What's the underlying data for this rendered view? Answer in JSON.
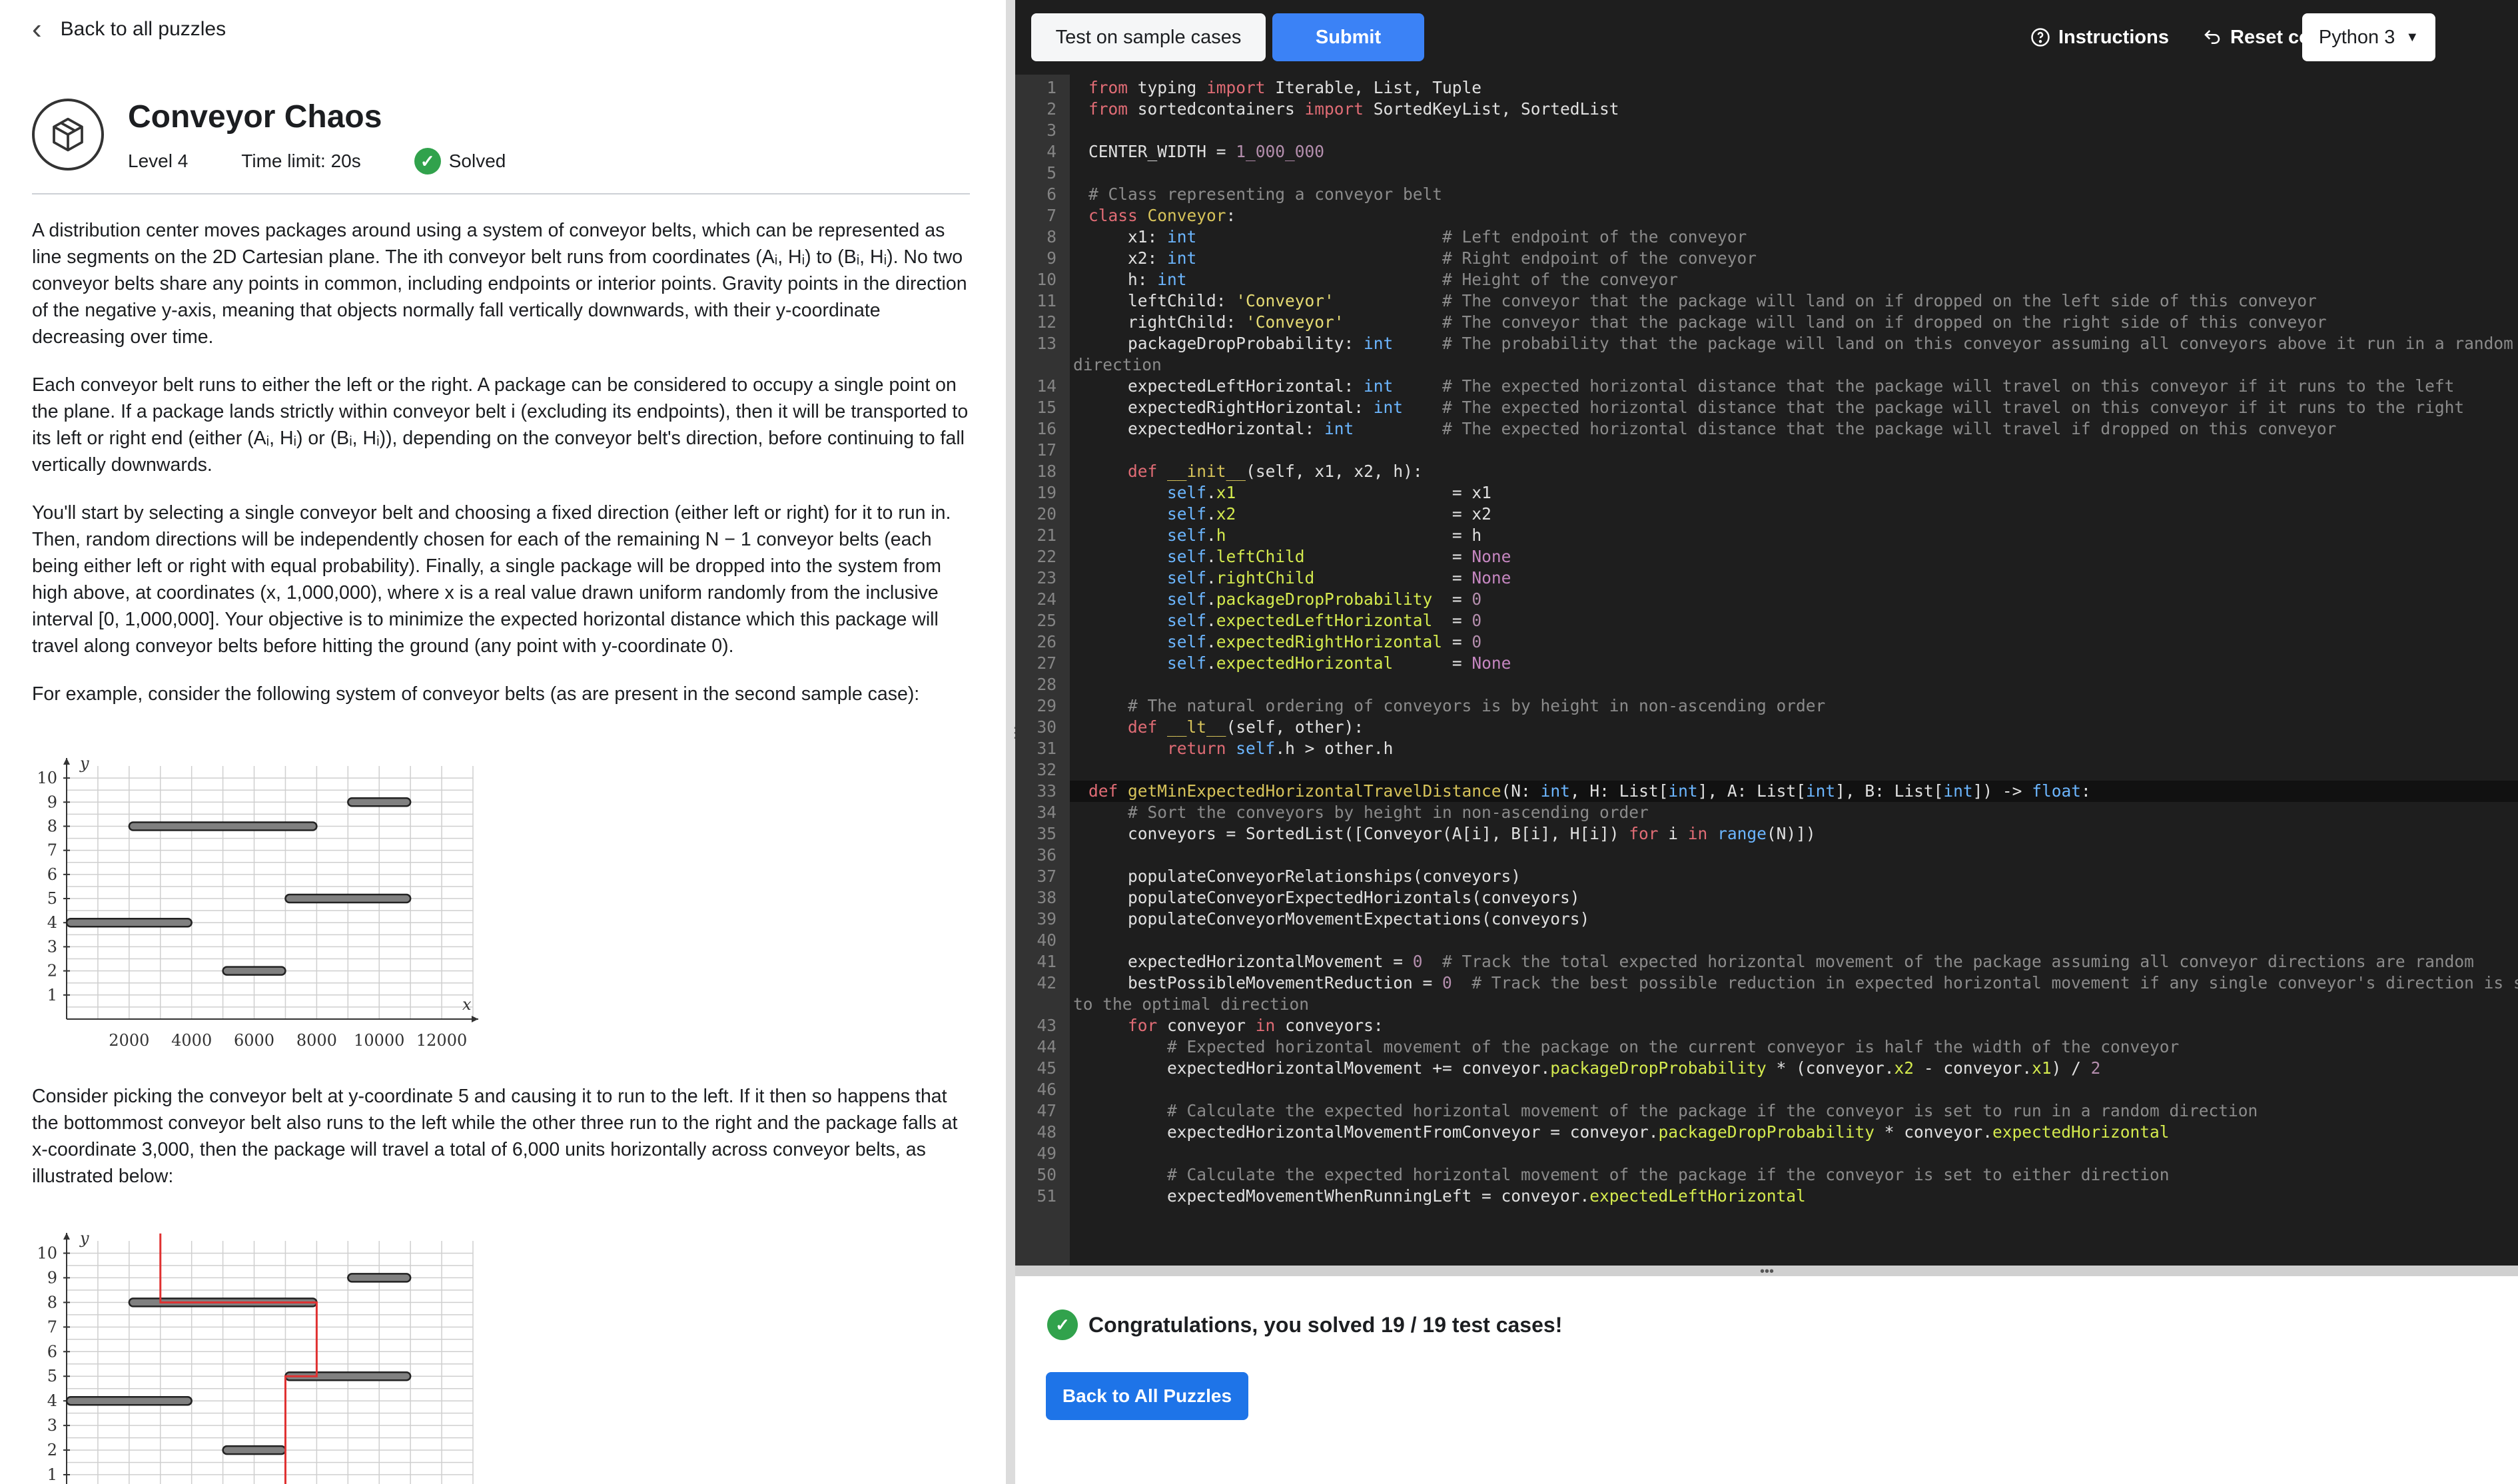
{
  "nav": {
    "back_label": "Back to all puzzles"
  },
  "puzzle": {
    "title": "Conveyor Chaos",
    "level": "Level 4",
    "time_limit": "Time limit: 20s",
    "status": "Solved"
  },
  "description": {
    "p1": "A distribution center moves packages around using a system of conveyor belts, which can be represented as line segments on the 2D Cartesian plane. The ith conveyor belt runs from coordinates (Aᵢ, Hᵢ) to (Bᵢ, Hᵢ). No two conveyor belts share any points in common, including endpoints or interior points. Gravity points in the direction of the negative y-axis, meaning that objects normally fall vertically downwards, with their y-coordinate decreasing over time.",
    "p2": "Each conveyor belt runs to either the left or the right. A package can be considered to occupy a single point on the plane. If a package lands strictly within conveyor belt i (excluding its endpoints), then it will be transported to its left or right end (either (Aᵢ, Hᵢ) or (Bᵢ, Hᵢ)), depending on the conveyor belt's direction, before continuing to fall vertically downwards.",
    "p3": "You'll start by selecting a single conveyor belt and choosing a fixed direction (either left or right) for it to run in. Then, random directions will be independently chosen for each of the remaining N − 1 conveyor belts (each being either left or right with equal probability). Finally, a single package will be dropped into the system from high above, at coordinates (x, 1,000,000), where x is a real value drawn uniform randomly from the inclusive interval [0, 1,000,000]. Your objective is to minimize the expected horizontal distance which this package will travel along conveyor belts before hitting the ground (any point with y-coordinate 0).",
    "p4": "For example, consider the following system of conveyor belts (as are present in the second sample case):",
    "p5": "Consider picking the conveyor belt at y-coordinate 5 and causing it to run to the left. If it then so happens that the bottommost conveyor belt also runs to the left while the other three run to the right and the package falls at x-coordinate 3,000, then the package will travel a total of 6,000 units horizontally across conveyor belts, as illustrated below:"
  },
  "chart_data": [
    {
      "type": "diagram",
      "xlabel": "x",
      "ylabel": "y",
      "xticks": [
        2000,
        4000,
        6000,
        8000,
        10000,
        12000
      ],
      "yticks": [
        1,
        2,
        3,
        4,
        5,
        6,
        7,
        8,
        9,
        10
      ],
      "xlim": [
        0,
        13000
      ],
      "ylim": [
        0,
        10.5
      ],
      "grid": true,
      "segments": [
        {
          "a": 0,
          "b": 4000,
          "h": 4
        },
        {
          "a": 5000,
          "b": 7000,
          "h": 2
        },
        {
          "a": 2000,
          "b": 8000,
          "h": 8
        },
        {
          "a": 7000,
          "b": 11000,
          "h": 5
        },
        {
          "a": 9000,
          "b": 11000,
          "h": 9
        }
      ]
    },
    {
      "type": "diagram",
      "xlabel": "",
      "ylabel": "y",
      "yticks": [
        1,
        2,
        3,
        4,
        5,
        6,
        7,
        8,
        9,
        10
      ],
      "xlim": [
        0,
        13000
      ],
      "ylim": [
        0,
        10.5
      ],
      "grid": true,
      "segments": [
        {
          "a": 0,
          "b": 4000,
          "h": 4
        },
        {
          "a": 5000,
          "b": 7000,
          "h": 2
        },
        {
          "a": 2000,
          "b": 8000,
          "h": 8
        },
        {
          "a": 7000,
          "b": 11000,
          "h": 5
        },
        {
          "a": 9000,
          "b": 11000,
          "h": 9
        }
      ],
      "package_path": [
        [
          3000,
          10.8
        ],
        [
          3000,
          8
        ],
        [
          8000,
          8
        ],
        [
          8000,
          5
        ],
        [
          7000,
          5
        ],
        [
          7000,
          0
        ]
      ]
    }
  ],
  "toolbar": {
    "test_label": "Test on sample cases",
    "submit_label": "Submit",
    "instructions_label": "Instructions",
    "reset_label": "Reset code",
    "language": "Python 3"
  },
  "results": {
    "message": "Congratulations, you solved 19 / 19 test cases!",
    "back_button": "Back to All Puzzles"
  },
  "colors": {
    "accent": "#3b82f6",
    "success": "#31a24c",
    "editor_bg": "#1e1e1e",
    "path": "#e03131"
  }
}
